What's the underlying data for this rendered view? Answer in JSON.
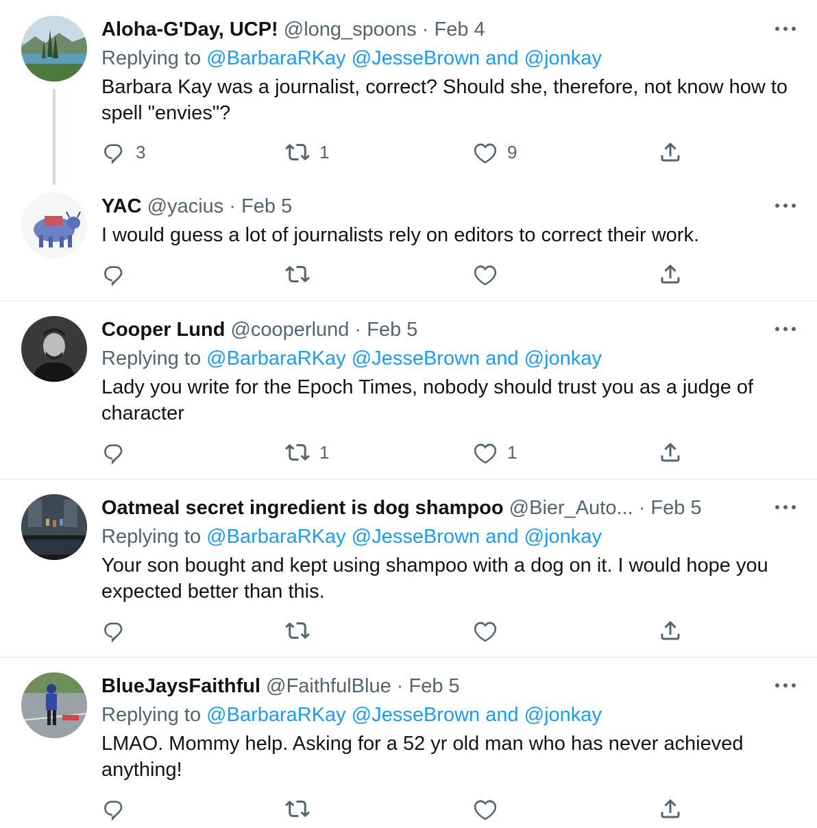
{
  "colors": {
    "text": "#0f1419",
    "secondary": "#536471",
    "link": "#1d9bf0",
    "divider": "#eff3f4"
  },
  "common": {
    "more_icon": "more-horizontal-icon",
    "reply_icon": "reply-bubble-icon",
    "retweet_icon": "retweet-icon",
    "like_icon": "heart-icon",
    "share_icon": "share-upload-icon",
    "separator": "·"
  },
  "tweets": [
    {
      "name": "Aloha-G'Day, UCP!",
      "handle": "@long_spoons",
      "date": "Feb 4",
      "replying_prefix": "Replying to",
      "replying_mentions": [
        "@BarbaraRKay",
        "@JesseBrown",
        "and",
        "@jonkay"
      ],
      "text": "Barbara Kay was a journalist, correct? Should she, therefore, not know how to spell \"envies\"?",
      "replies": "3",
      "retweets": "1",
      "likes": "9"
    },
    {
      "name": "YAC",
      "handle": "@yacius",
      "date": "Feb 5",
      "text": "I would guess a lot of journalists rely on editors to correct their work.",
      "replies": "",
      "retweets": "",
      "likes": ""
    },
    {
      "name": "Cooper Lund",
      "handle": "@cooperlund",
      "date": "Feb 5",
      "replying_prefix": "Replying to",
      "replying_mentions": [
        "@BarbaraRKay",
        "@JesseBrown",
        "and",
        "@jonkay"
      ],
      "text": "Lady you write for the Epoch Times, nobody should trust you as a judge of character",
      "replies": "",
      "retweets": "1",
      "likes": "1"
    },
    {
      "name": "Oatmeal secret ingredient is dog shampoo",
      "handle": "@Bier_Auto...",
      "date": "Feb 5",
      "replying_prefix": "Replying to",
      "replying_mentions": [
        "@BarbaraRKay",
        "@JesseBrown",
        "and",
        "@jonkay"
      ],
      "text": "Your son bought and kept using shampoo with a dog on it. I would hope you expected better than this.",
      "replies": "",
      "retweets": "",
      "likes": ""
    },
    {
      "name": "BlueJaysFaithful",
      "handle": "@FaithfulBlue",
      "date": "Feb 5",
      "replying_prefix": "Replying to",
      "replying_mentions": [
        "@BarbaraRKay",
        "@JesseBrown",
        "and",
        "@jonkay"
      ],
      "text": "LMAO. Mommy help. Asking for a 52 yr old man who has never achieved anything!",
      "replies": "",
      "retweets": "",
      "likes": ""
    }
  ]
}
